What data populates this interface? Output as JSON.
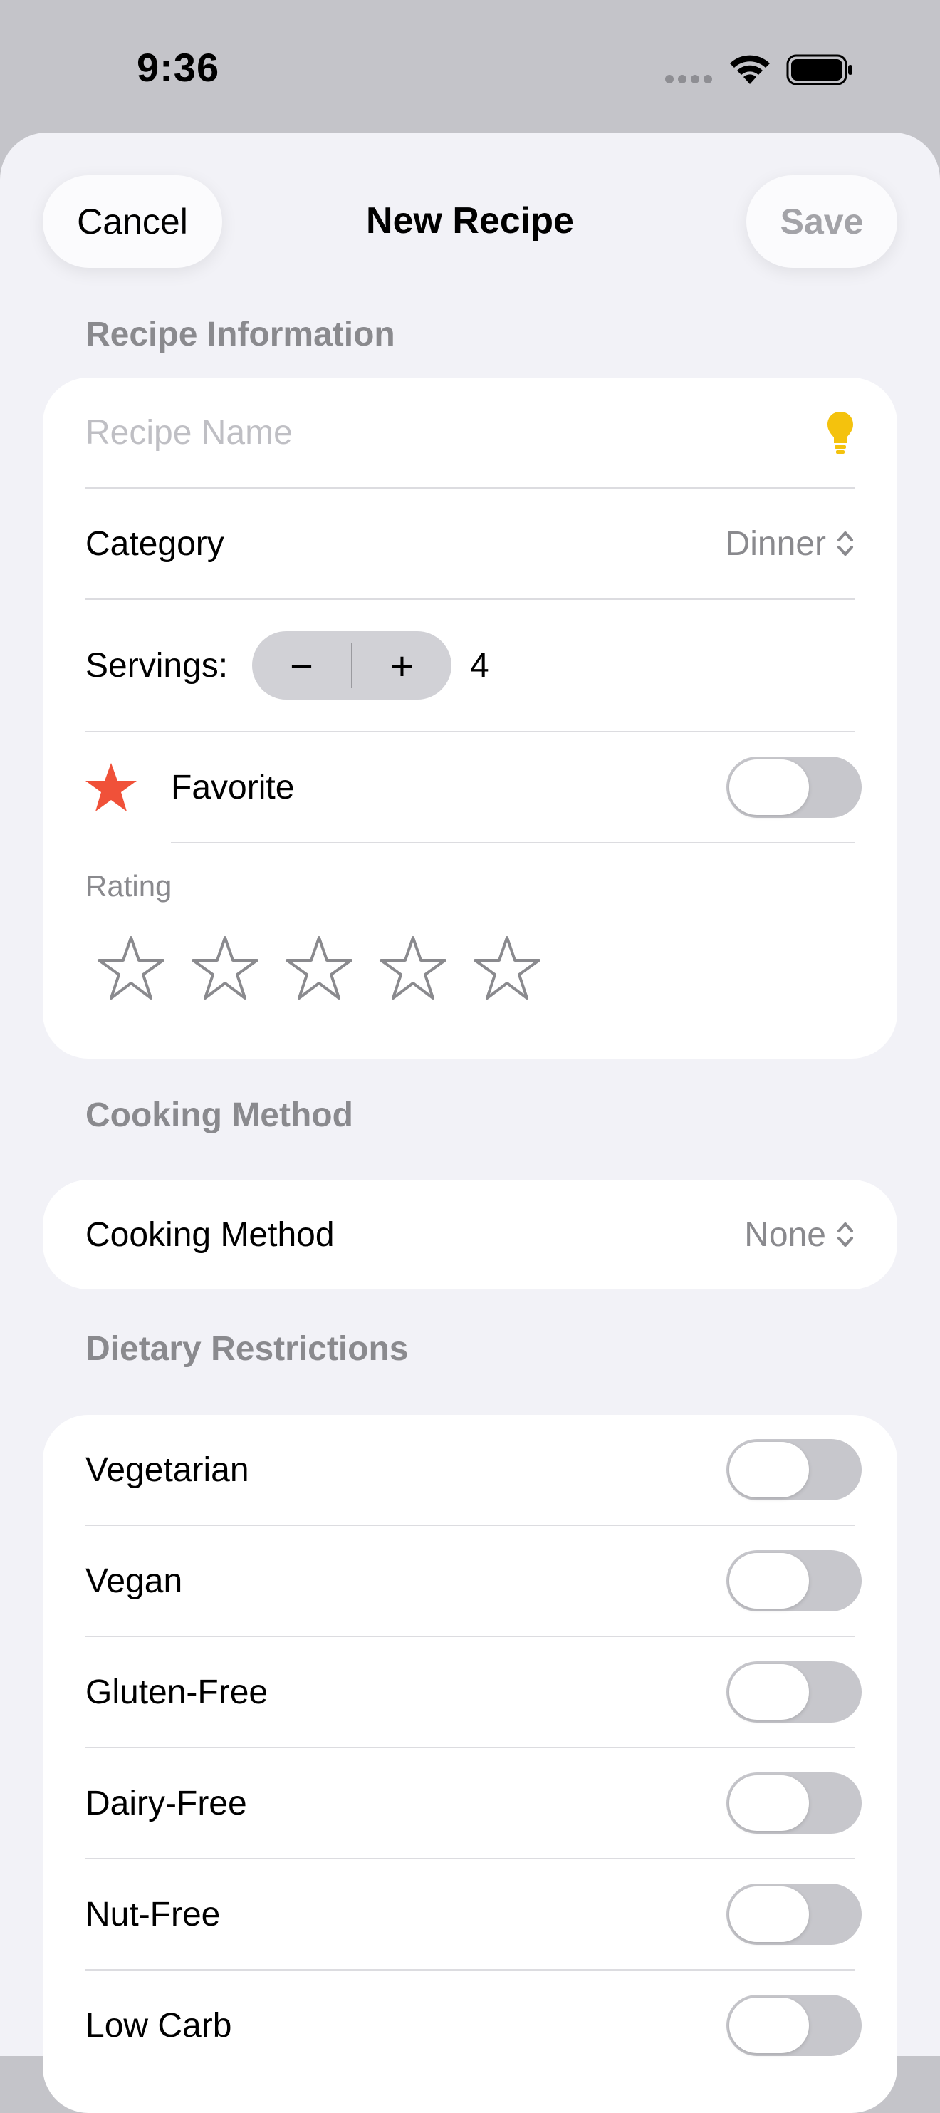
{
  "status_bar": {
    "time": "9:36"
  },
  "nav": {
    "cancel": "Cancel",
    "title": "New Recipe",
    "save": "Save"
  },
  "recipe_info": {
    "header": "Recipe Information",
    "name_placeholder": "Recipe Name",
    "category_label": "Category",
    "category_value": "Dinner",
    "servings_label": "Servings:",
    "servings_minus": "−",
    "servings_plus": "+",
    "servings_value": "4",
    "favorite_label": "Favorite",
    "favorite_on": false,
    "rating_label": "Rating",
    "rating_value": 0,
    "rating_max": 5,
    "icon_color": "#F4C20D",
    "star_color": "#F05139"
  },
  "cooking": {
    "header": "Cooking Method",
    "label": "Cooking Method",
    "value": "None"
  },
  "dietary": {
    "header": "Dietary Restrictions",
    "items": [
      {
        "label": "Vegetarian",
        "on": false
      },
      {
        "label": "Vegan",
        "on": false
      },
      {
        "label": "Gluten-Free",
        "on": false
      },
      {
        "label": "Dairy-Free",
        "on": false
      },
      {
        "label": "Nut-Free",
        "on": false
      },
      {
        "label": "Low Carb",
        "on": false
      }
    ]
  }
}
